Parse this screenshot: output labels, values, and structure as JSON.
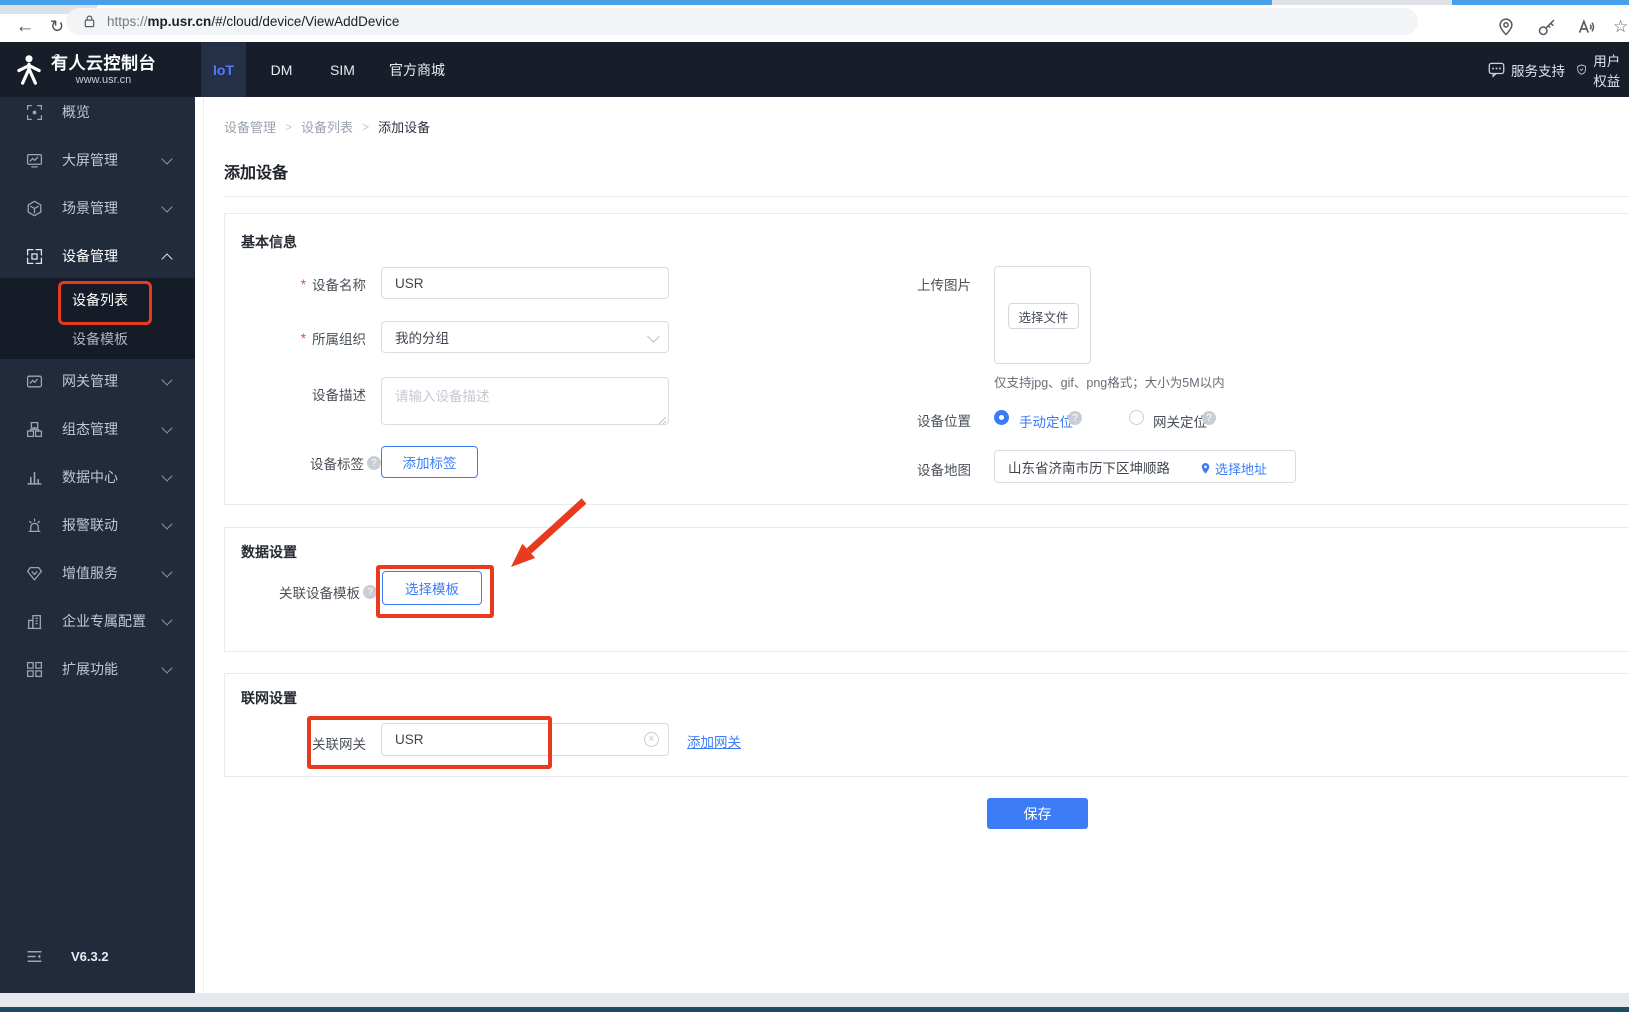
{
  "browser": {
    "url_scheme": "https://",
    "url_host": "mp.usr.cn",
    "url_path": "/#/cloud/device/ViewAddDevice",
    "icons": [
      "back-icon",
      "refresh-icon",
      "lock-icon",
      "location-pin-icon",
      "key-icon",
      "read-aloud-icon",
      "star-icon"
    ],
    "star_glyph": "☆"
  },
  "header": {
    "brand": {
      "title": "有人云控制台",
      "subtitle": "www.usr.cn"
    },
    "tabs": [
      {
        "label": "IoT",
        "active": true
      },
      {
        "label": "DM",
        "active": false
      },
      {
        "label": "SIM",
        "active": false
      },
      {
        "label": "官方商城",
        "active": false
      }
    ],
    "right": [
      {
        "label": "服务支持",
        "icon": "chat-icon"
      },
      {
        "label": "用户权益",
        "icon": "shield-icon"
      }
    ]
  },
  "sidebar": {
    "items": [
      {
        "label": "概览",
        "icon": "overview-icon"
      },
      {
        "label": "大屏管理",
        "icon": "screen-icon"
      },
      {
        "label": "场景管理",
        "icon": "scene-icon"
      },
      {
        "label": "设备管理",
        "icon": "device-icon",
        "expanded": true,
        "children": [
          {
            "label": "设备列表",
            "active": true,
            "annotated": true
          },
          {
            "label": "设备模板",
            "active": false
          }
        ]
      },
      {
        "label": "网关管理",
        "icon": "gateway-icon"
      },
      {
        "label": "组态管理",
        "icon": "scada-icon"
      },
      {
        "label": "数据中心",
        "icon": "data-center-icon"
      },
      {
        "label": "报警联动",
        "icon": "alarm-icon"
      },
      {
        "label": "增值服务",
        "icon": "value-service-icon"
      },
      {
        "label": "企业专属配置",
        "icon": "enterprise-icon"
      },
      {
        "label": "扩展功能",
        "icon": "extension-icon"
      }
    ],
    "version": "V6.3.2"
  },
  "breadcrumb": {
    "items": [
      "设备管理",
      "设备列表",
      "添加设备"
    ],
    "separator": ">"
  },
  "page": {
    "title": "添加设备"
  },
  "form": {
    "required_mark": "*",
    "help_mark": "?",
    "basic": {
      "section_title": "基本信息",
      "device_name": {
        "label": "设备名称",
        "value": "USR"
      },
      "organization": {
        "label": "所属组织",
        "value": "我的分组"
      },
      "description": {
        "label": "设备描述",
        "placeholder": "请输入设备描述"
      },
      "tags": {
        "label": "设备标签",
        "button": "添加标签"
      },
      "upload": {
        "label": "上传图片",
        "button": "选择文件",
        "hint": "仅支持jpg、gif、png格式；大小为5M以内"
      },
      "location": {
        "label": "设备位置",
        "options": [
          {
            "label": "手动定位",
            "selected": true
          },
          {
            "label": "网关定位",
            "selected": false
          }
        ]
      },
      "map": {
        "label": "设备地图",
        "value": "山东省济南市历下区坤顺路",
        "link": "选择地址"
      }
    },
    "data_settings": {
      "section_title": "数据设置",
      "template": {
        "label": "关联设备模板",
        "button": "选择模板"
      }
    },
    "network_settings": {
      "section_title": "联网设置",
      "gateway": {
        "label": "关联网关",
        "value": "USR",
        "link": "添加网关"
      }
    },
    "save_label": "保存"
  },
  "colors": {
    "accent_blue": "#3b7cf6",
    "annotation_red": "#e73a1e",
    "header_dark": "#171d29",
    "sidebar_dark": "#222b3c"
  }
}
